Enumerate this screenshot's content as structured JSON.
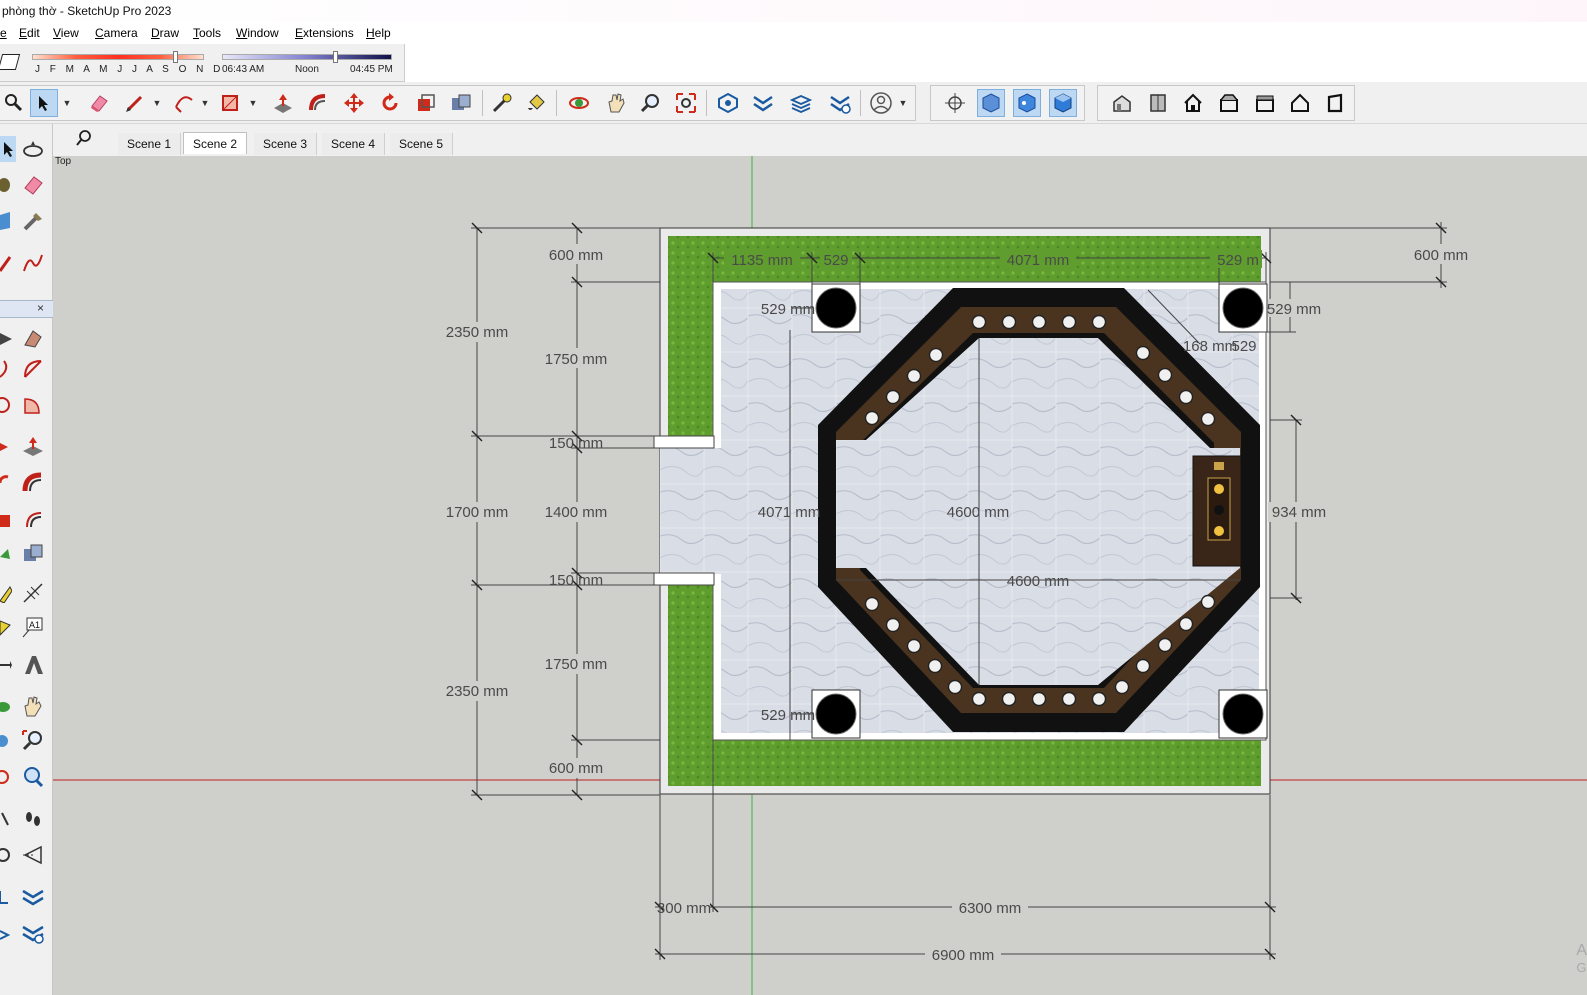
{
  "window": {
    "title": "phòng thờ - SketchUp Pro 2023"
  },
  "menu": {
    "items": [
      {
        "label": "e",
        "key": "file"
      },
      {
        "label": "Edit",
        "key": "edit"
      },
      {
        "label": "View",
        "key": "view"
      },
      {
        "label": "Camera",
        "key": "camera"
      },
      {
        "label": "Draw",
        "key": "draw"
      },
      {
        "label": "Tools",
        "key": "tools"
      },
      {
        "label": "Window",
        "key": "window"
      },
      {
        "label": "Extensions",
        "key": "extensions"
      },
      {
        "label": "Help",
        "key": "help"
      }
    ]
  },
  "shadows": {
    "months": "J F M A M J J A S O N D",
    "time_start": "06:43 AM",
    "time_mid": "Noon",
    "time_end": "04:45 PM"
  },
  "toolbar": {
    "icons": [
      "zoom-icon",
      "select-arrow-icon",
      "eraser-icon",
      "pencil-icon",
      "arc-icon",
      "rectangle-icon",
      "push-pull-icon",
      "follow-me-icon",
      "move-icon",
      "rotate-icon",
      "scale-icon",
      "offset-icon",
      "tape-measure-icon",
      "paint-bucket-icon",
      "orbit-icon",
      "pan-icon",
      "zoom-window-icon",
      "zoom-extents-icon",
      "warehouse-icon",
      "extension-warehouse-icon",
      "layout-icon",
      "extension-manager-icon",
      "account-icon",
      "axes-icon",
      "xray-icon",
      "back-edges-icon",
      "wireframe-icon",
      "iso-view-icon",
      "front-view-icon",
      "home-view-icon",
      "right-view-icon",
      "back-view-icon",
      "left-view-icon",
      "top-view-icon"
    ]
  },
  "scenes": {
    "tabs": [
      "Scene 1",
      "Scene 2",
      "Scene 3",
      "Scene 4",
      "Scene 5"
    ],
    "active": "Scene 2"
  },
  "viewport": {
    "view_label": "Top",
    "watermark_1": "A",
    "watermark_2": "G"
  },
  "dimensions": {
    "top_left_600": "600 mm",
    "top_right_600": "600 mm",
    "d1135": "1135 mm",
    "d529_top": "529",
    "d4071_top": "4071 mm",
    "d529_top_right": "529 m",
    "left_2350_top": "2350 mm",
    "left_1750_top": "1750 mm",
    "d529_left_top": "529 mm",
    "d529_right_top": "529 mm",
    "d168": "168 mm",
    "d529_diag": "529",
    "d150_top": "150 mm",
    "left_1700": "1700 mm",
    "left_1400": "1400 mm",
    "d4071_mid": "4071 mm",
    "d4600_vert": "4600 mm",
    "d934": "934 mm",
    "d150_bottom": "150 mm",
    "d4600_horiz": "4600 mm",
    "left_1750_bottom": "1750 mm",
    "left_2350_bottom": "2350 mm",
    "d529_left_bottom": "529 mm",
    "bottom_left_600": "600 mm",
    "d300": "300 mm",
    "d6300": "6300 mm",
    "d6900": "6900 mm"
  }
}
